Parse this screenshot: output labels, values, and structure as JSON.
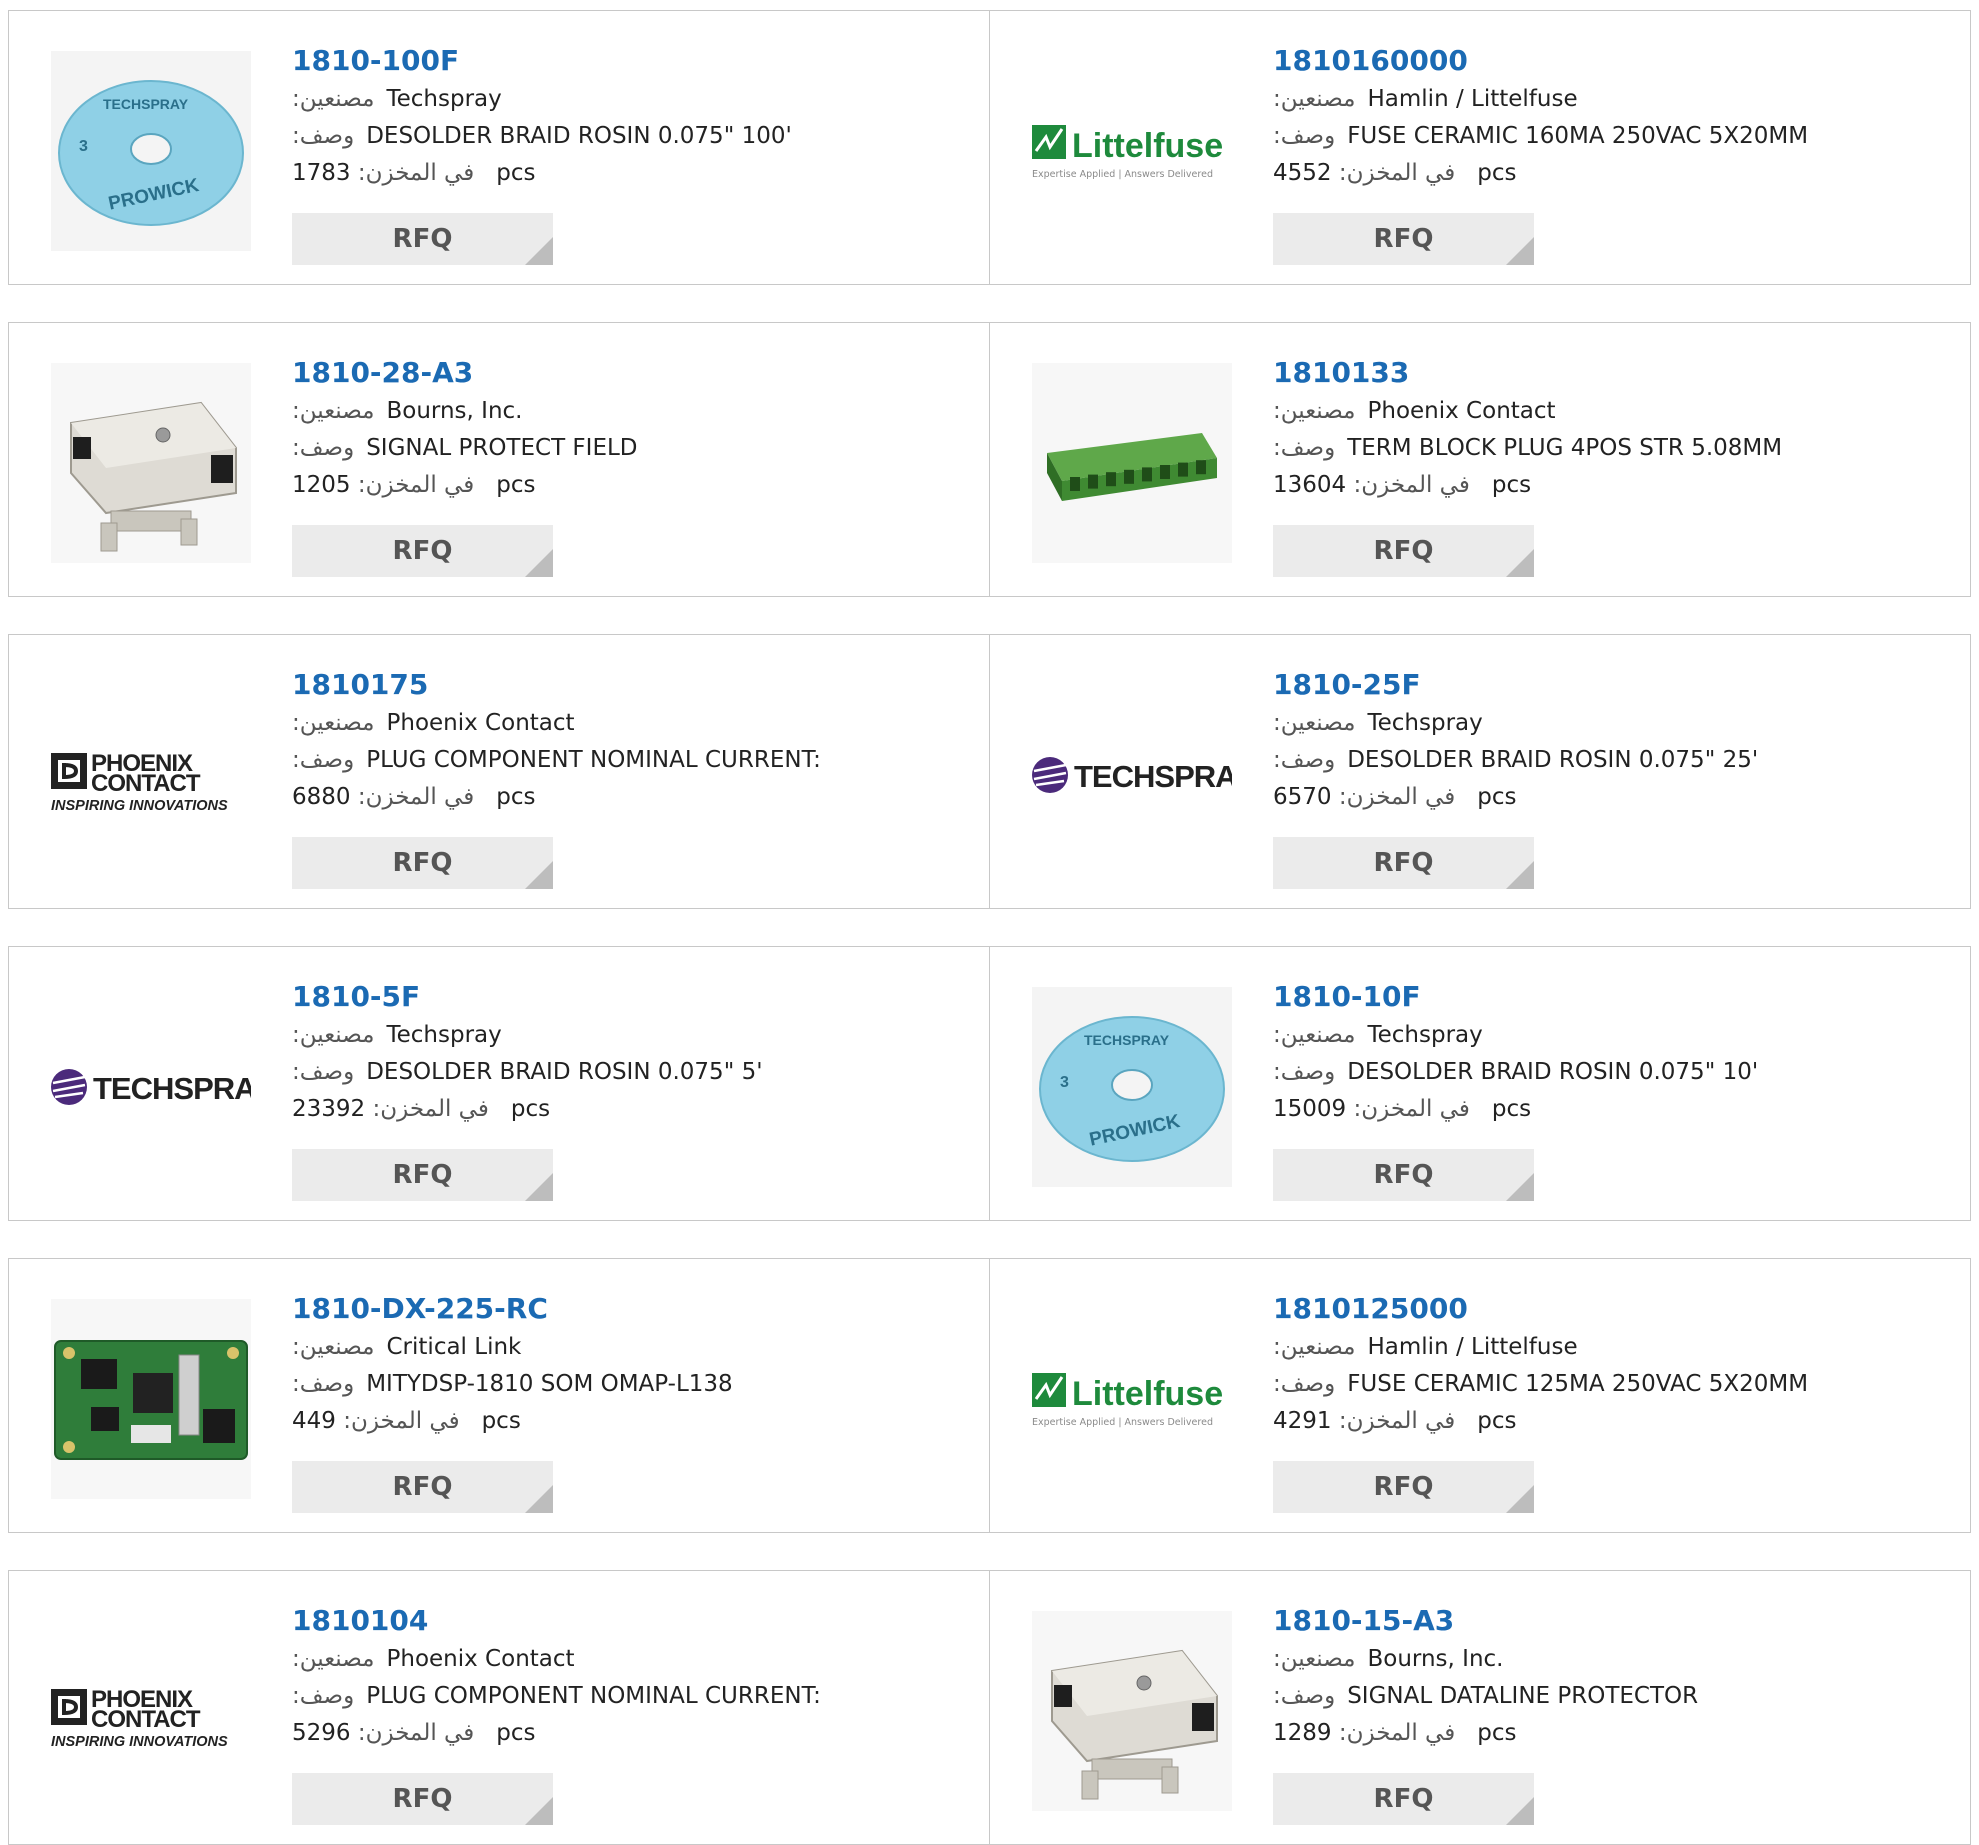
{
  "labels": {
    "manufacturer": "مصنعين:",
    "description": "وصف:",
    "stock": "في المخزن:",
    "unit": "pcs",
    "rfq": "RFQ"
  },
  "products": [
    {
      "part": "1810-100F",
      "mfr": "Techspray",
      "desc": "DESOLDER BRAID ROSIN 0.075\" 100'",
      "stock": "1783",
      "image": "prowick-reel-icon"
    },
    {
      "part": "1810160000",
      "mfr": "Hamlin / Littelfuse",
      "desc": "FUSE CERAMIC 160MA 250VAC 5X20MM",
      "stock": "4552",
      "image": "littelfuse-logo"
    },
    {
      "part": "1810-28-A3",
      "mfr": "Bourns, Inc.",
      "desc": "SIGNAL PROTECT FIELD",
      "stock": "1205",
      "image": "protector-module-icon"
    },
    {
      "part": "1810133",
      "mfr": "Phoenix Contact",
      "desc": "TERM BLOCK PLUG 4POS STR 5.08MM",
      "stock": "13604",
      "image": "terminal-block-icon"
    },
    {
      "part": "1810175",
      "mfr": "Phoenix Contact",
      "desc": "PLUG COMPONENT NOMINAL CURRENT:",
      "stock": "6880",
      "image": "phoenix-contact-logo"
    },
    {
      "part": "1810-25F",
      "mfr": "Techspray",
      "desc": "DESOLDER BRAID ROSIN 0.075\" 25'",
      "stock": "6570",
      "image": "techspray-logo"
    },
    {
      "part": "1810-5F",
      "mfr": "Techspray",
      "desc": "DESOLDER BRAID ROSIN 0.075\" 5'",
      "stock": "23392",
      "image": "techspray-logo"
    },
    {
      "part": "1810-10F",
      "mfr": "Techspray",
      "desc": "DESOLDER BRAID ROSIN 0.075\" 10'",
      "stock": "15009",
      "image": "prowick-reel-icon"
    },
    {
      "part": "1810-DX-225-RC",
      "mfr": "Critical Link",
      "desc": "MITYDSP-1810 SOM OMAP-L138",
      "stock": "449",
      "image": "circuit-board-icon"
    },
    {
      "part": "1810125000",
      "mfr": "Hamlin / Littelfuse",
      "desc": "FUSE CERAMIC 125MA 250VAC 5X20MM",
      "stock": "4291",
      "image": "littelfuse-logo"
    },
    {
      "part": "1810104",
      "mfr": "Phoenix Contact",
      "desc": "PLUG COMPONENT NOMINAL CURRENT:",
      "stock": "5296",
      "image": "phoenix-contact-logo"
    },
    {
      "part": "1810-15-A3",
      "mfr": "Bourns, Inc.",
      "desc": "SIGNAL DATALINE PROTECTOR",
      "stock": "1289",
      "image": "protector-module-icon"
    }
  ],
  "logo_text": {
    "techspray": "TECHSPRAY",
    "littelfuse": "Littelfuse",
    "littelfuse_tagline": "Expertise Applied | Answers Delivered",
    "phoenix_line1": "PHOENIX",
    "phoenix_line2": "CONTACT",
    "phoenix_tagline": "INSPIRING INNOVATIONS",
    "prowick_brand": "TECHSPRAY",
    "prowick_name": "PROWICK",
    "prowick_size": "3"
  },
  "colors": {
    "part_link": "#1b6ab3",
    "rfq_bg": "#ebebeb",
    "border": "#c8c8c8",
    "littelfuse_green": "#1e8a3c",
    "techspray_purple": "#4b2a7b",
    "reel_blue": "#8fd0e6"
  }
}
